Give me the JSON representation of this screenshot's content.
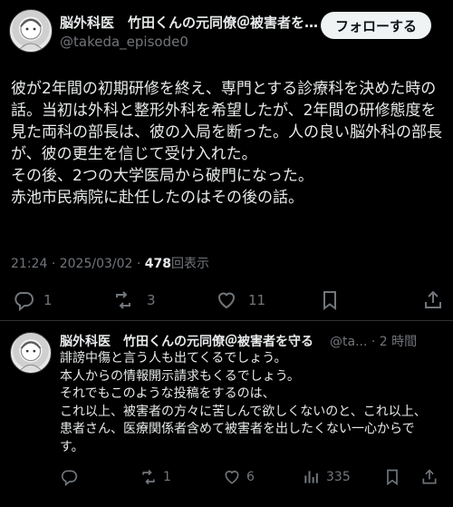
{
  "tweet": {
    "author_name": "脳外科医　竹田くんの元同僚＠被害者を…",
    "author_handle": "@takeda_episode0",
    "follow_label": "フォローする",
    "lines": [
      "彼が2年間の初期研修を終え、専門とする診療科を決めた時の",
      "話。当初は外科と整形外科を希望したが、2年間の研修態度を",
      "見た両科の部長は、彼の入局を断った。人の良い脳外科の部長",
      "が、彼の更生を信じて受け入れた。",
      "その後、2つの大学医局から破門になった。",
      "赤池市民病院に赴任したのはその後の話。"
    ],
    "time": "21:24",
    "date": "2025/03/02",
    "separator": "·",
    "views_count": "478",
    "views_label": "回表示",
    "reply_count": "1",
    "retweet_count": "3",
    "like_count": "11"
  },
  "reply": {
    "author_name": "脳外科医　竹田くんの元同僚＠被害者を守る",
    "handle_time": "@ta... · 2 時間",
    "lines": [
      "誹謗中傷と言う人も出てくるでしょう。",
      "本人からの情報開示請求もくるでしょう。",
      "それでもこのような投稿をするのは、",
      "これ以上、被害者の方々に苦しんで欲しくないのと、これ以上、",
      "患者さん、医療関係者含めて被害者を出したくない一心からで",
      "す。"
    ],
    "reply_count": "",
    "retweet_count": "1",
    "like_count": "6",
    "views_count": "335"
  },
  "colors": {
    "background": "#000000",
    "text": "#e7e9ea",
    "muted": "#71767b",
    "button_bg": "#eff3f4"
  }
}
